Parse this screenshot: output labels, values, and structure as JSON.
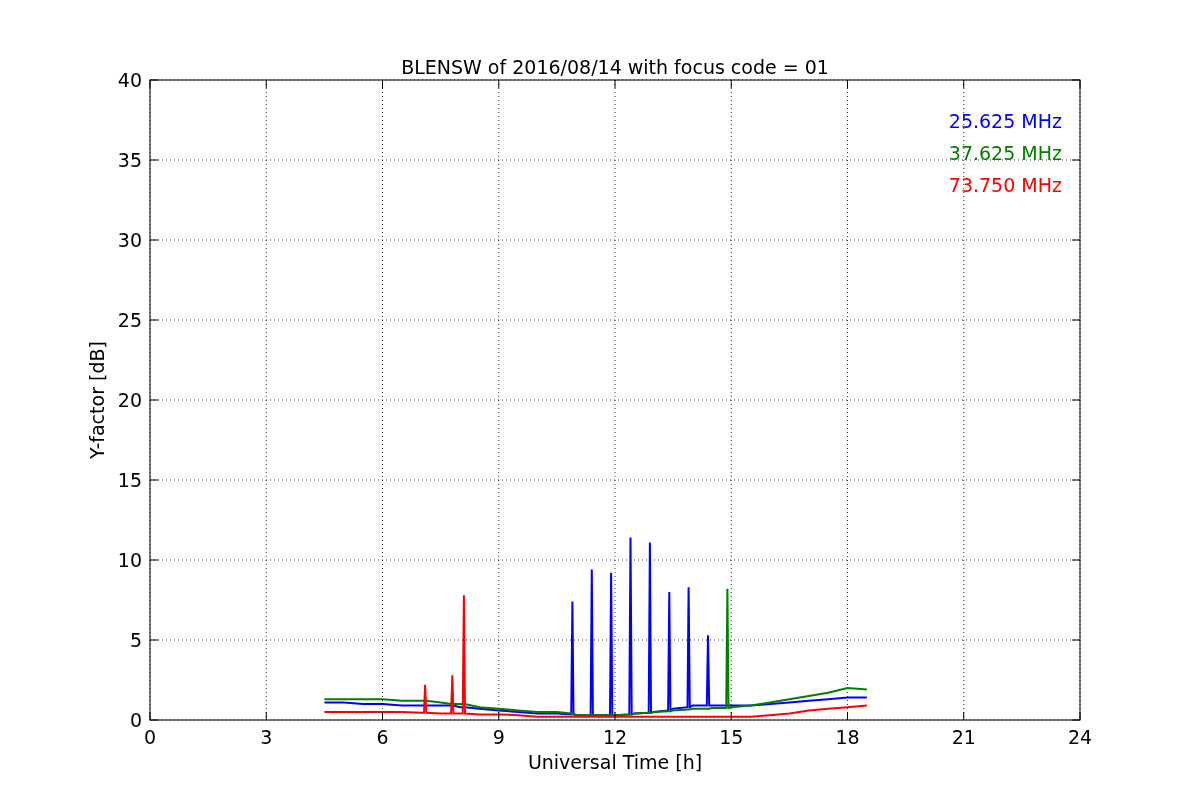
{
  "figure": {
    "chart_data": {
      "type": "line",
      "grid": true,
      "title": "BLENSW of 2016/08/14 with focus code = 01",
      "xlabel": "Universal Time [h]",
      "ylabel": "Y-factor [dB]",
      "xlim": [
        0,
        24
      ],
      "ylim": [
        0,
        40
      ],
      "xticks": [
        0,
        3,
        6,
        9,
        12,
        15,
        18,
        21,
        24
      ],
      "yticks": [
        0,
        5,
        10,
        15,
        20,
        25,
        30,
        35,
        40
      ],
      "x": [
        4.5,
        5,
        5.5,
        6,
        6.5,
        7,
        7.07,
        7.1,
        7.13,
        7.5,
        7.77,
        7.8,
        7.83,
        8,
        8.07,
        8.1,
        8.13,
        8.5,
        9,
        9.5,
        10,
        10.5,
        10.87,
        10.9,
        10.93,
        11,
        11.37,
        11.4,
        11.43,
        11.5,
        11.87,
        11.9,
        11.93,
        12,
        12.37,
        12.4,
        12.43,
        12.5,
        12.87,
        12.9,
        12.93,
        13,
        13.37,
        13.4,
        13.43,
        13.5,
        13.87,
        13.9,
        13.93,
        14,
        14.37,
        14.4,
        14.43,
        14.5,
        14.87,
        14.9,
        14.93,
        15,
        15.5,
        16,
        16.5,
        17,
        17.5,
        18,
        18.5
      ],
      "series": [
        {
          "name": "25.625 MHz",
          "color": "#0000ff",
          "values": [
            1.1,
            1.1,
            1.0,
            1.0,
            0.9,
            0.9,
            0.9,
            0.9,
            0.9,
            0.9,
            0.9,
            0.9,
            0.9,
            0.8,
            0.8,
            0.8,
            0.8,
            0.7,
            0.6,
            0.5,
            0.4,
            0.4,
            0.35,
            7.4,
            0.35,
            0.3,
            0.3,
            9.4,
            0.3,
            0.3,
            0.3,
            9.2,
            0.3,
            0.3,
            0.35,
            11.4,
            0.35,
            0.4,
            0.45,
            11.1,
            0.45,
            0.5,
            0.6,
            8.0,
            0.6,
            0.7,
            0.8,
            8.3,
            0.8,
            0.9,
            0.9,
            5.3,
            0.9,
            0.9,
            0.9,
            0.9,
            0.9,
            0.9,
            0.9,
            1.0,
            1.1,
            1.2,
            1.3,
            1.4,
            1.4
          ]
        },
        {
          "name": "37.625 MHz",
          "color": "#008000",
          "values": [
            1.3,
            1.3,
            1.3,
            1.3,
            1.2,
            1.2,
            1.2,
            1.2,
            1.2,
            1.1,
            1.0,
            1.0,
            1.0,
            1.0,
            1.0,
            1.0,
            1.0,
            0.8,
            0.7,
            0.6,
            0.5,
            0.5,
            0.4,
            0.4,
            0.4,
            0.3,
            0.3,
            0.3,
            0.3,
            0.3,
            0.3,
            0.3,
            0.3,
            0.3,
            0.35,
            0.35,
            0.35,
            0.4,
            0.45,
            0.45,
            0.45,
            0.5,
            0.55,
            0.55,
            0.55,
            0.6,
            0.65,
            0.65,
            0.65,
            0.7,
            0.7,
            0.7,
            0.7,
            0.75,
            0.75,
            8.2,
            0.75,
            0.8,
            0.9,
            1.1,
            1.3,
            1.5,
            1.7,
            2.0,
            1.9
          ]
        },
        {
          "name": "73.750 MHz",
          "color": "#ff0000",
          "values": [
            0.5,
            0.5,
            0.5,
            0.5,
            0.5,
            0.45,
            0.45,
            2.2,
            0.45,
            0.4,
            0.4,
            2.8,
            0.4,
            0.4,
            0.4,
            7.8,
            0.4,
            0.35,
            0.35,
            0.3,
            0.2,
            0.2,
            0.2,
            0.2,
            0.2,
            0.2,
            0.2,
            0.2,
            0.2,
            0.2,
            0.2,
            0.2,
            0.2,
            0.2,
            0.2,
            0.2,
            0.2,
            0.2,
            0.2,
            0.2,
            0.2,
            0.2,
            0.2,
            0.2,
            0.2,
            0.2,
            0.2,
            0.2,
            0.2,
            0.2,
            0.2,
            0.2,
            0.2,
            0.2,
            0.2,
            0.2,
            0.2,
            0.2,
            0.2,
            0.3,
            0.4,
            0.6,
            0.7,
            0.8,
            0.9
          ]
        }
      ]
    }
  }
}
